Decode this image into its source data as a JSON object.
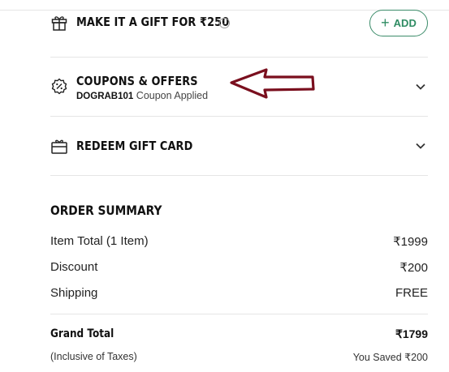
{
  "gift": {
    "title": "MAKE IT A GIFT FOR ₹250",
    "info_glyph": "i",
    "add_label": "ADD",
    "add_plus": "+",
    "icon": "gift-icon",
    "accent_color": "#2f8c63"
  },
  "coupons": {
    "title": "COUPONS & OFFERS",
    "code": "DOGRAB101",
    "applied_text": "Coupon Applied",
    "icon": "discount-badge-icon"
  },
  "gift_card": {
    "title": "REDEEM GIFT CARD",
    "icon": "gift-card-icon"
  },
  "order_summary": {
    "title": "ORDER SUMMARY",
    "rows": [
      {
        "label": "Item Total (1 Item)",
        "value": "₹1999"
      },
      {
        "label": "Discount",
        "value": "₹200"
      },
      {
        "label": "Shipping",
        "value": "FREE"
      }
    ],
    "grand_total_label": "Grand Total",
    "grand_total_value": "₹1799",
    "tax_note": "(Inclusive of Taxes)",
    "saved_text": "You Saved ₹200"
  },
  "annotation": {
    "arrow_color": "#7a0f1e",
    "icon": "left-arrow-annotation"
  }
}
